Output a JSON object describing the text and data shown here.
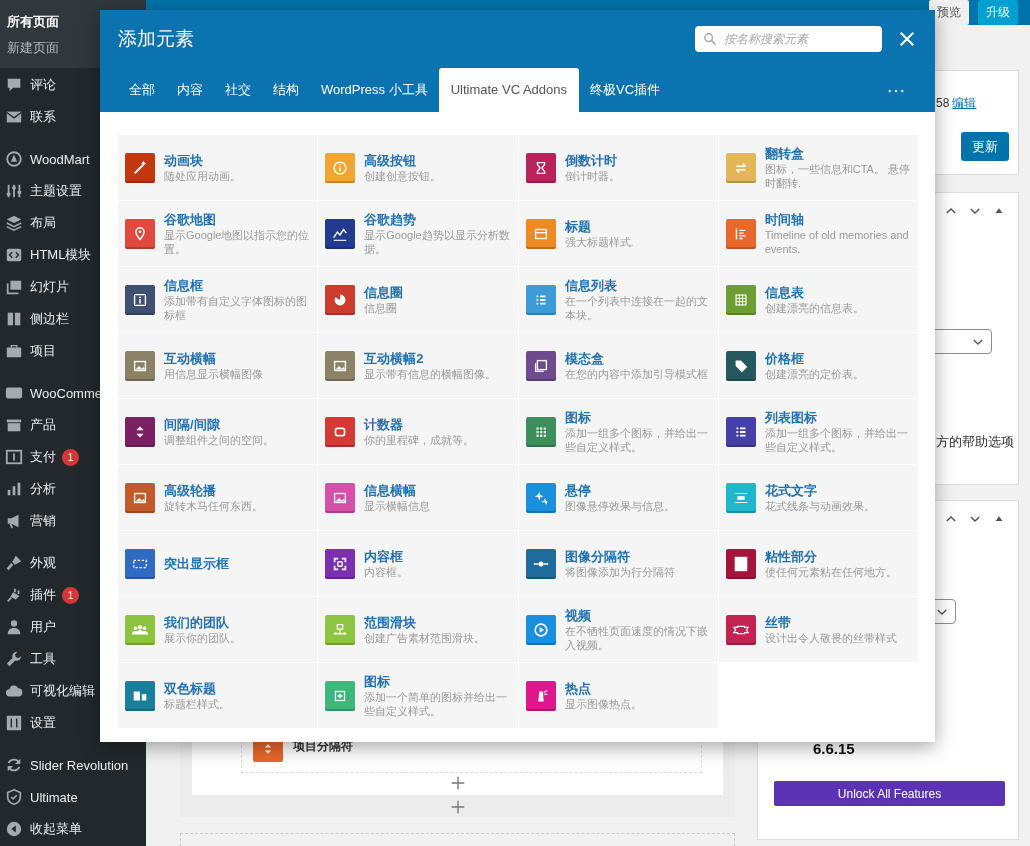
{
  "sidebar": {
    "submenu": [
      {
        "label": "所有页面",
        "selected": true
      },
      {
        "label": "新建页面",
        "selected": false
      }
    ],
    "sections": [
      {
        "items": [
          {
            "label": "评论"
          },
          {
            "label": "联系"
          }
        ]
      },
      {
        "items": [
          {
            "label": "WoodMart"
          },
          {
            "label": "主题设置"
          },
          {
            "label": "布局"
          },
          {
            "label": "HTML模块"
          },
          {
            "label": "幻灯片"
          },
          {
            "label": "侧边栏"
          },
          {
            "label": "项目"
          }
        ]
      },
      {
        "items": [
          {
            "label": "WooComme"
          },
          {
            "label": "产品"
          },
          {
            "label": "支付",
            "badge": "1"
          },
          {
            "label": "分析"
          },
          {
            "label": "营销"
          }
        ]
      },
      {
        "items": [
          {
            "label": "外观"
          },
          {
            "label": "插件",
            "badge": "1"
          },
          {
            "label": "用户"
          },
          {
            "label": "工具"
          },
          {
            "label": "可视化编辑"
          },
          {
            "label": "设置"
          }
        ]
      },
      {
        "items": [
          {
            "label": "Slider Revolution"
          },
          {
            "label": "Ultimate"
          },
          {
            "label": "收起菜单"
          }
        ]
      }
    ]
  },
  "admin_bar": {
    "buttons": [
      {
        "label": "预览",
        "kind": "secondary"
      },
      {
        "label": "升级",
        "kind": "primary"
      }
    ]
  },
  "publish_panel": {
    "revision": "58",
    "revision_link": "编辑",
    "button": "更新"
  },
  "help_text": "方的帮助选项",
  "version": "6.6.15",
  "unlock_button": "Unlock All Features",
  "editor": {
    "element": "项目分隔符"
  },
  "modal": {
    "title": "添加元素",
    "search": {
      "placeholder": "按名称搜索元素"
    },
    "tabs": [
      {
        "label": "全部",
        "selected": false
      },
      {
        "label": "内容",
        "selected": false
      },
      {
        "label": "社交",
        "selected": false
      },
      {
        "label": "结构",
        "selected": false
      },
      {
        "label": "WordPress 小工具",
        "selected": false
      },
      {
        "label": "Ultimate VC Addons",
        "selected": true
      },
      {
        "label": "终极VC插件",
        "selected": false
      }
    ],
    "items": [
      {
        "title": "动画块",
        "description": "随处应用动画。",
        "color": "#c1380f"
      },
      {
        "title": "高级按钮",
        "description": "创建创意按钮。",
        "color": "#f3a532"
      },
      {
        "title": "倒数计时",
        "description": "倒计时器。",
        "color": "#b8245a"
      },
      {
        "title": "翻转盒",
        "description": "图标，一些信息和CTA。 悬停时翻转.",
        "color": "#e3b757"
      },
      {
        "title": "谷歌地图",
        "description": "显示Google地图以指示您的位置。",
        "color": "#df4a3c"
      },
      {
        "title": "谷歌趋势",
        "description": "显示Google趋势以显示分析数据。",
        "color": "#213a8f"
      },
      {
        "title": "标题",
        "description": "强大标题样式.",
        "color": "#ee8a22"
      },
      {
        "title": "时间轴",
        "description": "Timeline of old memories and events.",
        "color": "#e8682b"
      },
      {
        "title": "信息框",
        "description": "添加带有自定义字体图标的图标框",
        "color": "#3f5070"
      },
      {
        "title": "信息圈",
        "description": "信息圈",
        "color": "#cd3b2d"
      },
      {
        "title": "信息列表",
        "description": "在一个列表中连接在一起的文本块。",
        "color": "#3d9bd8"
      },
      {
        "title": "信息表",
        "description": "创建漂亮的信息表。",
        "color": "#6e9d34"
      },
      {
        "title": "互动横幅",
        "description": "用信息显示横幅图像",
        "color": "#8b8266"
      },
      {
        "title": "互动横幅2",
        "description": "显示带有信息的横幅图像。",
        "color": "#8b8267"
      },
      {
        "title": "模态盒",
        "description": "在您的内容中添加引导模式框",
        "color": "#6e4b8e"
      },
      {
        "title": "价格框",
        "description": "创建漂亮的定价表。",
        "color": "#25585e"
      },
      {
        "title": "间隔/间隙",
        "description": "调整组件之间的空间。",
        "color": "#7b2063"
      },
      {
        "title": "计数器",
        "description": "你的里程碑，成就等。",
        "color": "#d33a35"
      },
      {
        "title": "图标",
        "description": "添加一组多个图标，并给出一些自定义样式。",
        "color": "#3c8f5a"
      },
      {
        "title": "列表图标",
        "description": "添加一组多个图标，并给出一些自定义样式。",
        "color": "#4540a8"
      },
      {
        "title": "高级轮播",
        "description": "旋转木马任何东西。",
        "color": "#c35a2b"
      },
      {
        "title": "信息横幅",
        "description": "显示横幅信息",
        "color": "#d64fa8"
      },
      {
        "title": "悬停",
        "description": "图像悬停效果与信息。",
        "color": "#1a8fdc"
      },
      {
        "title": "花式文字",
        "description": "花式线条与动画效果。",
        "color": "#1eb7cb"
      },
      {
        "title": "突出显示框",
        "color": "#2f6bc2"
      },
      {
        "title": "内容框",
        "description": "内容框。",
        "color": "#7a2fb0"
      },
      {
        "title": "图像分隔符",
        "description": "将图像添加为行分隔符",
        "color": "#1f6b9b"
      },
      {
        "title": "粘性部分",
        "description": "使任何元素粘在任何地方。",
        "color": "#a5143a"
      },
      {
        "title": "我们的团队",
        "description": "展示你的团队。",
        "color": "#8dc43f"
      },
      {
        "title": "范围滑块",
        "description": "创建广告素材范围滑块。",
        "color": "#8dc440"
      },
      {
        "title": "视频",
        "description": "在不牺牲页面速度的情况下嵌入视频。",
        "color": "#1a8fe0"
      },
      {
        "title": "丝带",
        "description": "设计出令人敬畏的丝带样式",
        "color": "#c42352"
      },
      {
        "title": "双色标题",
        "description": "标题栏样式。",
        "color": "#1a7f9c"
      },
      {
        "title": "图标",
        "description": "添加一个简单的图标并给出一些自定义样式。",
        "color": "#3eb77a"
      },
      {
        "title": "热点",
        "description": "显示图像热点。",
        "color": "#e0168c"
      }
    ]
  }
}
